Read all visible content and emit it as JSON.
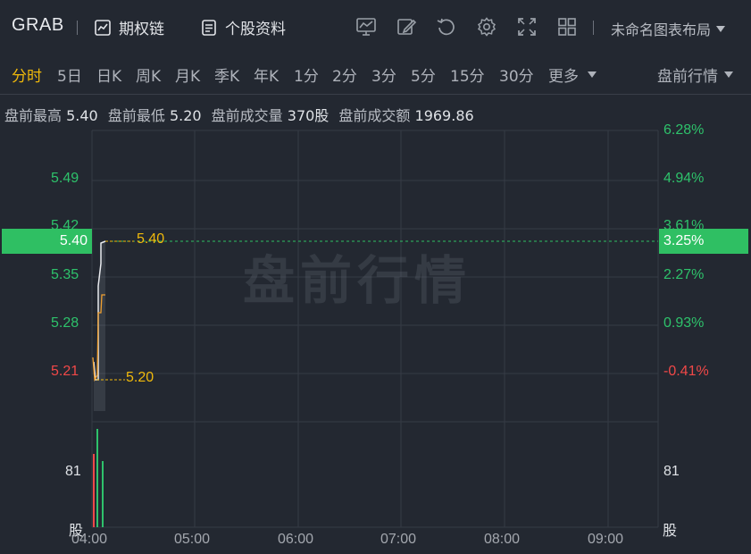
{
  "header": {
    "ticker": "GRAB",
    "options_chain": "期权链",
    "stock_info": "个股资料",
    "layout_name": "未命名图表布局"
  },
  "periods": [
    "分时",
    "5日",
    "日K",
    "周K",
    "月K",
    "季K",
    "年K",
    "1分",
    "2分",
    "3分",
    "5分",
    "15分",
    "30分",
    "更多"
  ],
  "active_period": "分时",
  "session_select": "盘前行情",
  "stats": {
    "high_label": "盘前最高",
    "high": "5.40",
    "low_label": "盘前最低",
    "low": "5.20",
    "volume_label": "盘前成交量",
    "volume": "370股",
    "amount_label": "盘前成交额",
    "amount": "1969.86"
  },
  "price_axis": [
    {
      "label": "5.49",
      "color": "green"
    },
    {
      "label": "5.42",
      "color": "green"
    },
    {
      "label": "5.35",
      "color": "green"
    },
    {
      "label": "5.28",
      "color": "green"
    },
    {
      "label": "5.21",
      "color": "red"
    }
  ],
  "pct_axis": [
    {
      "label": "6.28%",
      "color": "green"
    },
    {
      "label": "4.94%",
      "color": "green"
    },
    {
      "label": "3.61%",
      "color": "green"
    },
    {
      "label": "2.27%",
      "color": "green"
    },
    {
      "label": "0.93%",
      "color": "green"
    },
    {
      "label": "-0.41%",
      "color": "red"
    }
  ],
  "current_price": "5.40",
  "current_pct": "3.25%",
  "high_marker": "5.40",
  "low_marker": "5.20",
  "watermark": "盘前行情",
  "volume_axis_left": "81",
  "volume_axis_right": "81",
  "volume_unit_left": "股",
  "volume_unit_right": "股",
  "time_axis": [
    "04:00",
    "05:00",
    "06:00",
    "07:00",
    "08:00",
    "09:00"
  ],
  "colors": {
    "up": "#2ec26b",
    "down": "#f04848",
    "accent": "#f0b90b",
    "background": "#232831"
  }
}
